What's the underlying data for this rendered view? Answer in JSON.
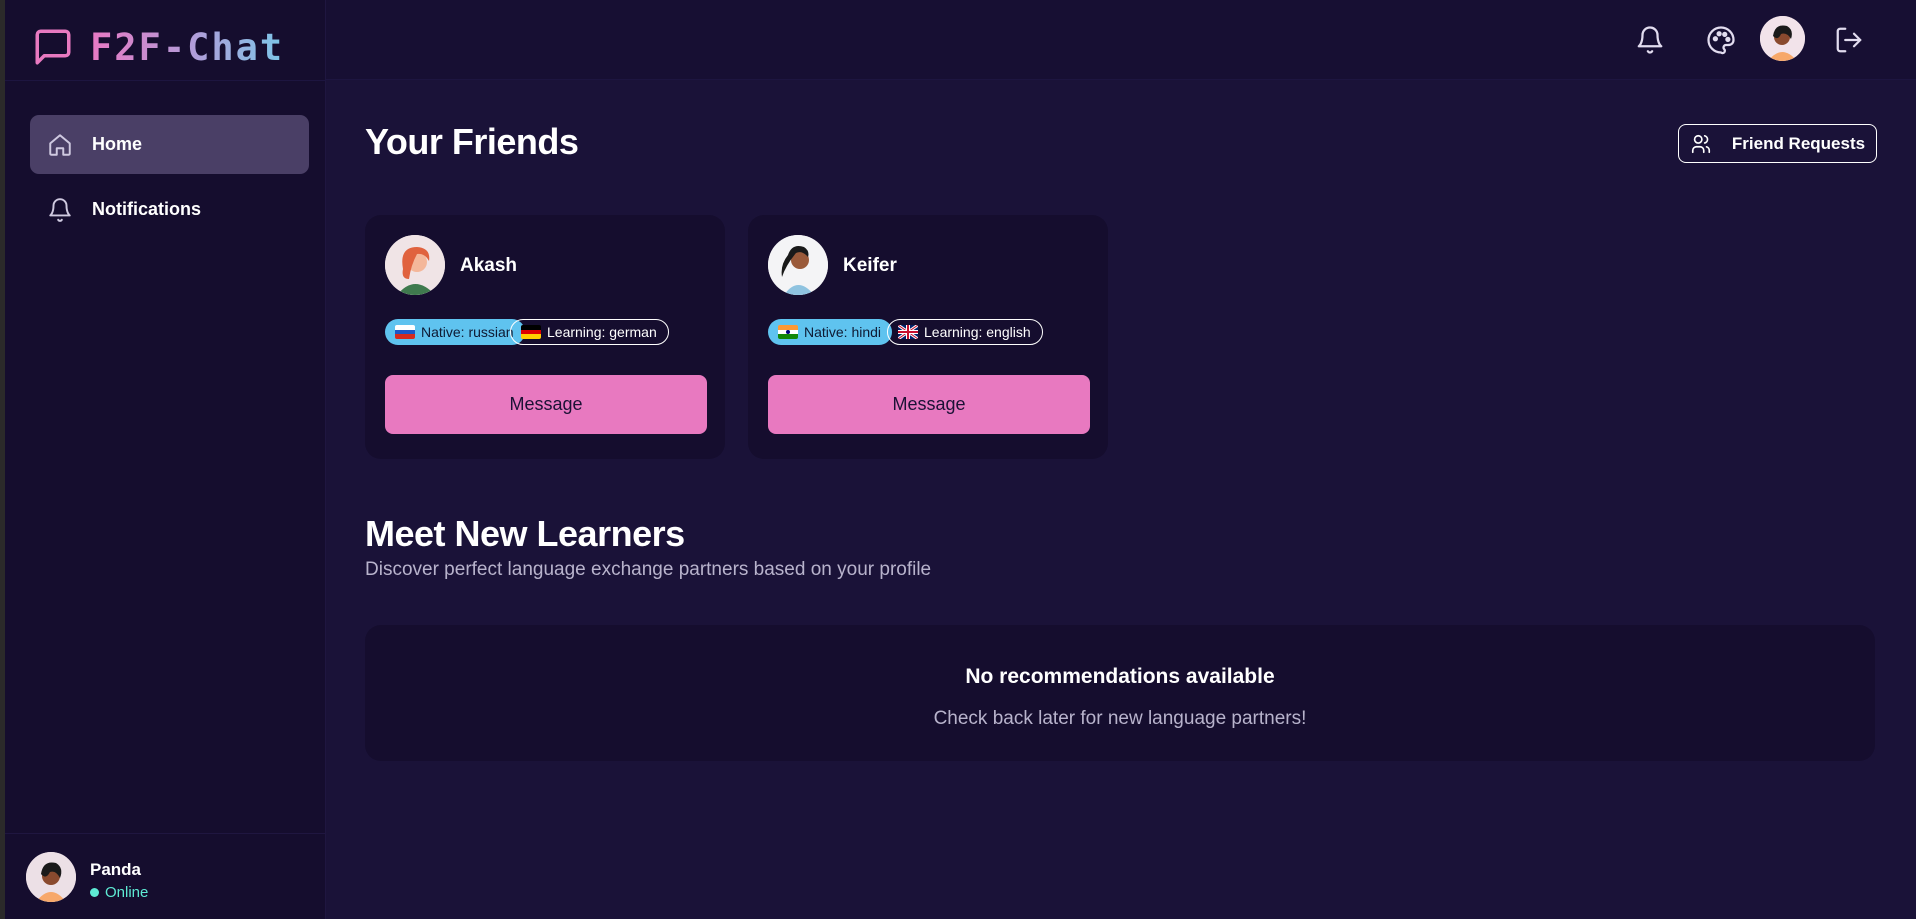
{
  "app": {
    "logo_text": "F2F-Chat",
    "accent_pink": "#e879c0",
    "accent_blue": "#5fc3ef"
  },
  "sidebar": {
    "items": [
      {
        "label": "Home",
        "icon": "home-icon",
        "active": true
      },
      {
        "label": "Notifications",
        "icon": "bell-icon",
        "active": false
      }
    ],
    "user": {
      "name": "Panda",
      "status": "Online"
    }
  },
  "topbar": {
    "icons": [
      "bell-icon",
      "palette-icon",
      "avatar",
      "logout-icon"
    ]
  },
  "main": {
    "friends_title": "Your Friends",
    "friend_requests_label": "Friend Requests",
    "friends": [
      {
        "name": "Akash",
        "native": "Native: russian",
        "native_flag": "russia-flag",
        "learning": "Learning: german",
        "learning_flag": "germany-flag",
        "message_label": "Message"
      },
      {
        "name": "Keifer",
        "native": "Native: hindi",
        "native_flag": "india-flag",
        "learning": "Learning: english",
        "learning_flag": "uk-flag",
        "message_label": "Message"
      }
    ],
    "learners_title": "Meet New Learners",
    "learners_subtitle": "Discover perfect language exchange partners based on your profile",
    "empty": {
      "title": "No recommendations available",
      "subtitle": "Check back later for new language partners!"
    }
  }
}
